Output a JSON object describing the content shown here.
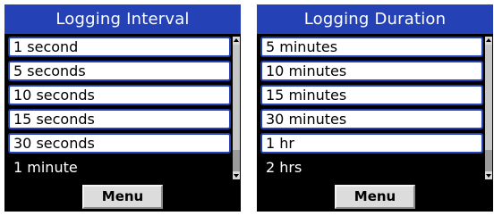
{
  "colors": {
    "title_bar": "#2441b6",
    "item_border": "#2441b6",
    "selected_background": "#000000",
    "menu_button": "#dcdcdc"
  },
  "screens": [
    {
      "title": "Logging Interval",
      "items": [
        {
          "label": "1 second",
          "selected": false
        },
        {
          "label": "5 seconds",
          "selected": false
        },
        {
          "label": "10 seconds",
          "selected": false
        },
        {
          "label": "15 seconds",
          "selected": false
        },
        {
          "label": "30 seconds",
          "selected": false
        },
        {
          "label": "1 minute",
          "selected": true
        }
      ],
      "scroll_position_fraction": 0.0,
      "menu_label": "Menu"
    },
    {
      "title": "Logging Duration",
      "items": [
        {
          "label": "5 minutes",
          "selected": false
        },
        {
          "label": "10 minutes",
          "selected": false
        },
        {
          "label": "15 minutes",
          "selected": false
        },
        {
          "label": "30 minutes",
          "selected": false
        },
        {
          "label": "1 hr",
          "selected": false
        },
        {
          "label": "2 hrs",
          "selected": true
        }
      ],
      "scroll_position_fraction": 0.0,
      "menu_label": "Menu"
    }
  ]
}
